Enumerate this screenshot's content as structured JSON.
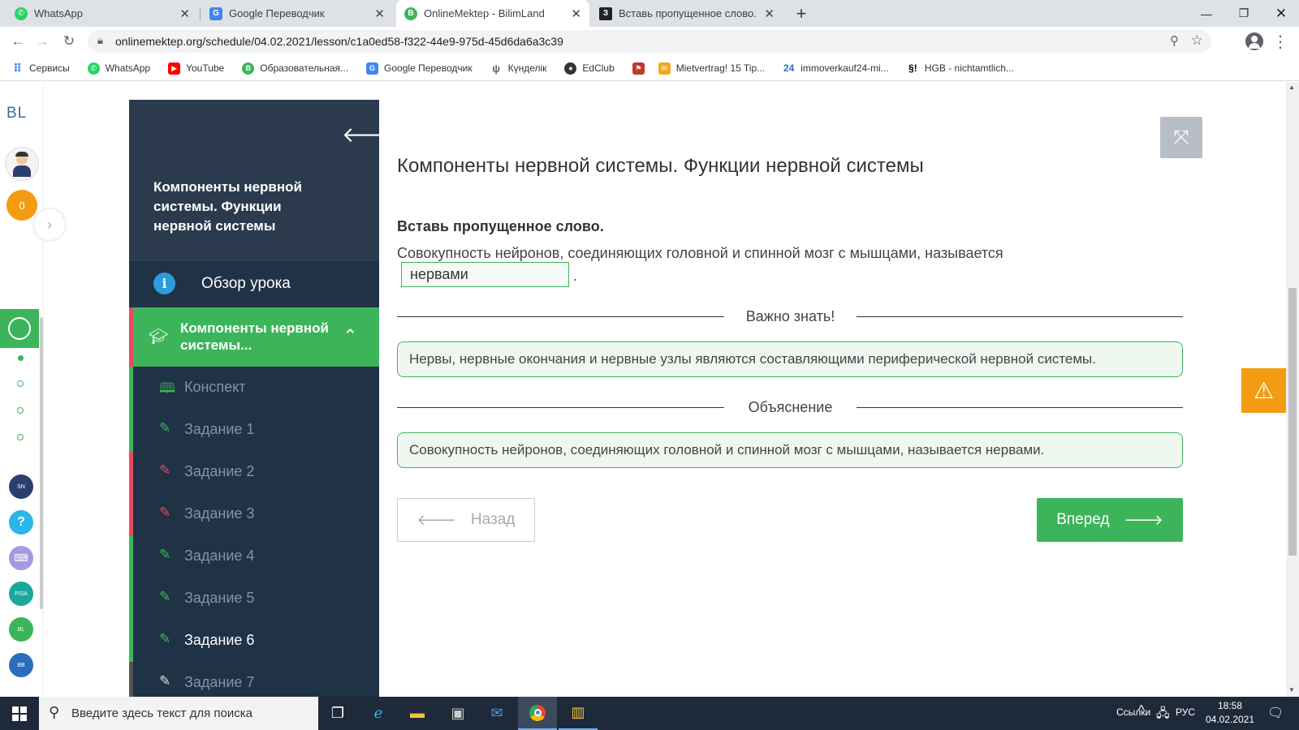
{
  "browser": {
    "tabs": [
      {
        "title": "WhatsApp",
        "icon": "whatsapp-icon",
        "color": "#25d366"
      },
      {
        "title": "Google Переводчик",
        "icon": "google-translate-icon",
        "color": "#4285f4"
      },
      {
        "title": "OnlineMektep - BilimLand",
        "icon": "onlinemektep-icon",
        "color": "#3cb55a"
      },
      {
        "title": "Вставь пропущенное слово. Со",
        "icon": "znanija-icon",
        "color": "#222222",
        "favicon_text": "З"
      }
    ],
    "url": "onlinemektep.org/schedule/04.02.2021/lesson/c1a0ed58-f322-44e9-975d-45d6da6a3c39",
    "bookmarks": [
      {
        "label": "Сервисы",
        "icon": "apps-grid-icon",
        "color": "#4285f4"
      },
      {
        "label": "WhatsApp",
        "icon": "whatsapp-icon",
        "color": "#25d366"
      },
      {
        "label": "YouTube",
        "icon": "youtube-icon",
        "color": "#ff0000"
      },
      {
        "label": "Образовательная...",
        "icon": "bilimland-icon",
        "color": "#3cb55a"
      },
      {
        "label": "Google Переводчик",
        "icon": "google-translate-icon",
        "color": "#4285f4"
      },
      {
        "label": "Күнделік",
        "icon": "kundelik-icon",
        "color": "#888888"
      },
      {
        "label": "EdClub",
        "icon": "edclub-icon",
        "color": "#333333"
      },
      {
        "label": "",
        "icon": "flag-icon",
        "color": "#c0392b"
      },
      {
        "label": "Mietvertrag! 15 Tip...",
        "icon": "mietvertrag-icon",
        "color": "#f5a623"
      },
      {
        "label": "immoverkauf24-mi...",
        "icon": "immoverkauf-icon",
        "color": "#2a6ebb",
        "favicon_text": "24"
      },
      {
        "label": "HGB - nichtamtlich...",
        "icon": "paragraph-icon",
        "color": "#000000",
        "favicon_text": "§!"
      }
    ]
  },
  "leftbar": {
    "logo": "BL",
    "coins": "0"
  },
  "sidebar": {
    "title": "Компоненты нервной системы. Функции нервной системы",
    "overview": "Обзор урока",
    "section": "Компоненты нервной системы...",
    "items": [
      {
        "label": "Конспект",
        "icon": "book-icon",
        "status": "#3cb55a"
      },
      {
        "label": "Задание 1",
        "icon": "edit-icon",
        "status": "#3cb55a"
      },
      {
        "label": "Задание 2",
        "icon": "edit-icon",
        "status": "#e84a5f"
      },
      {
        "label": "Задание 3",
        "icon": "edit-icon",
        "status": "#e84a5f"
      },
      {
        "label": "Задание 4",
        "icon": "edit-icon",
        "status": "#3cb55a"
      },
      {
        "label": "Задание 5",
        "icon": "edit-icon",
        "status": "#3cb55a"
      },
      {
        "label": "Задание 6",
        "icon": "edit-icon",
        "status": "#3cb55a"
      },
      {
        "label": "Задание 7",
        "icon": "edit-icon",
        "status": "#555555"
      }
    ]
  },
  "main": {
    "title": "Компоненты нервной системы. Функции нервной системы",
    "instruction": "Вставь пропущенное слово.",
    "sentence": "Совокупность нейронов, соединяющих головной и спинной мозг с мышцами, называется",
    "answer": "нервами",
    "period": ".",
    "important_label": "Важно знать!",
    "important_text": "Нервы, нервные окончания и нервные узлы являются составляющими периферической нервной системы.",
    "explanation_label": "Объяснение",
    "explanation_text": "Совокупность нейронов, соединяющих головной и спинной мозг с мышцами, называется нервами.",
    "back": "Назад",
    "next": "Вперед"
  },
  "taskbar": {
    "search_placeholder": "Введите здесь текст для поиска",
    "links": "Ссылки",
    "lang": "РУС",
    "time": "18:58",
    "date": "04.02.2021"
  },
  "colors": {
    "accent": "#3cb55a",
    "sidebar_bg": "#1f3246",
    "error": "#e84a5f",
    "warning": "#f39c12"
  }
}
